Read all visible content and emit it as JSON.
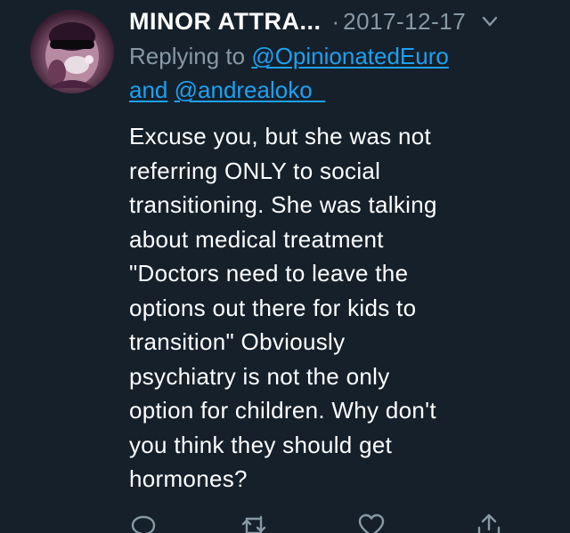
{
  "tweet": {
    "author_name": "MINOR ATTRA...",
    "separator": "·",
    "date": "2017-12-17",
    "reply_prefix": "Replying to",
    "mention_1": "@OpinionatedEuro",
    "reply_joiner": "and",
    "mention_2": "@andrealoko_",
    "body_lines": [
      "Excuse you, but she was not",
      "referring ONLY to social",
      "transitioning. She was talking",
      "about medical treatment",
      "\"Doctors need to leave the",
      "options out there for kids to",
      "transition\" Obviously",
      "psychiatry is not the only",
      "option for children. Why don't",
      "you think they should get",
      "hormones?"
    ]
  },
  "actions": {
    "icons": [
      "reply-icon",
      "retweet-icon",
      "like-icon",
      "share-icon"
    ]
  },
  "colors": {
    "background": "#15202b",
    "text": "#ffffff",
    "secondary": "#8899a6",
    "link": "#1da1f2"
  }
}
